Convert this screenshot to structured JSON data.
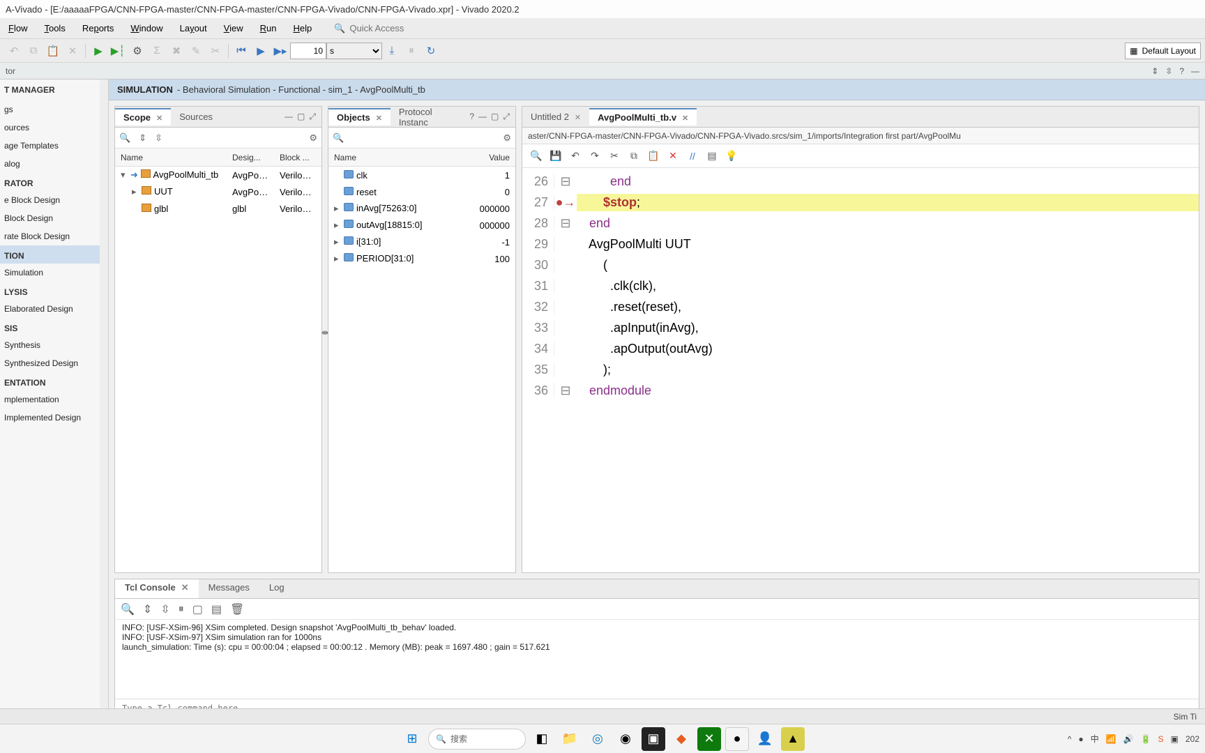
{
  "window": {
    "title": "A-Vivado - [E:/aaaaaFPGA/CNN-FPGA-master/CNN-FPGA-master/CNN-FPGA-Vivado/CNN-FPGA-Vivado.xpr] - Vivado 2020.2"
  },
  "menu": [
    "Flow",
    "Tools",
    "Reports",
    "Window",
    "Layout",
    "View",
    "Run",
    "Help"
  ],
  "quick_access": {
    "placeholder": "Quick Access"
  },
  "toolbar": {
    "time_value": "10",
    "time_unit": "s",
    "layout": "Default Layout"
  },
  "nav_title": "tor",
  "sim_header": {
    "label": "SIMULATION",
    "desc": "- Behavioral Simulation - Functional - sim_1 - AvgPoolMulti_tb"
  },
  "left_nav": {
    "title": "T MANAGER",
    "groups": [
      {
        "items": [
          "gs",
          "ources",
          "age Templates",
          "alog"
        ]
      },
      {
        "cat": "RATOR",
        "items": [
          "e Block Design",
          "Block Design",
          "rate Block Design"
        ]
      },
      {
        "cat": "TION",
        "sel": true,
        "items": [
          "Simulation"
        ]
      },
      {
        "cat": "LYSIS",
        "items": [
          " Elaborated Design"
        ]
      },
      {
        "cat": "SIS",
        "items": [
          "Synthesis",
          " Synthesized Design"
        ]
      },
      {
        "cat": "ENTATION",
        "items": [
          "mplementation",
          " Implemented Design"
        ]
      }
    ]
  },
  "scope": {
    "tabs": [
      "Scope",
      "Sources"
    ],
    "cols": [
      "Name",
      "Desig...",
      "Block ..."
    ],
    "rows": [
      {
        "indent": 0,
        "exp": "▾",
        "arrow": true,
        "name": "AvgPoolMulti_tb",
        "d": "AvgPoolM",
        "b": "Verilog Mo"
      },
      {
        "indent": 1,
        "exp": "▸",
        "name": "UUT",
        "d": "AvgPoolM",
        "b": "Verilog Mo"
      },
      {
        "indent": 1,
        "exp": "",
        "name": "glbl",
        "d": "glbl",
        "b": "Verilog Mo"
      }
    ]
  },
  "objects": {
    "tabs": [
      "Objects",
      "Protocol Instanc"
    ],
    "cols": [
      "Name",
      "Value"
    ],
    "rows": [
      {
        "exp": "",
        "name": "clk",
        "val": "1"
      },
      {
        "exp": "",
        "name": "reset",
        "val": "0"
      },
      {
        "exp": "▸",
        "name": "inAvg[75263:0]",
        "val": "000000"
      },
      {
        "exp": "▸",
        "name": "outAvg[18815:0]",
        "val": "000000"
      },
      {
        "exp": "▸",
        "name": "i[31:0]",
        "val": "-1"
      },
      {
        "exp": "▸",
        "name": "PERIOD[31:0]",
        "val": "100"
      }
    ]
  },
  "editor": {
    "tabs": [
      {
        "label": "Untitled 2",
        "active": false
      },
      {
        "label": "AvgPoolMulti_tb.v",
        "active": true
      }
    ],
    "path": "aster/CNN-FPGA-master/CNN-FPGA-Vivado/CNN-FPGA-Vivado.srcs/sim_1/imports/Integration first part/AvgPoolMu",
    "lines": [
      {
        "n": 26,
        "fold": "⊟",
        "t": "        end"
      },
      {
        "n": 27,
        "bp": "●→",
        "hl": true,
        "t": "      $stop;",
        "stop": true
      },
      {
        "n": 28,
        "fold": "⊟",
        "t": "  end"
      },
      {
        "n": 29,
        "t": "  AvgPoolMulti UUT"
      },
      {
        "n": 30,
        "t": "      ("
      },
      {
        "n": 31,
        "t": "        .clk(clk),"
      },
      {
        "n": 32,
        "t": "        .reset(reset),"
      },
      {
        "n": 33,
        "t": "        .apInput(inAvg),"
      },
      {
        "n": 34,
        "t": "        .apOutput(outAvg)"
      },
      {
        "n": 35,
        "t": "      );"
      },
      {
        "n": 36,
        "fold": "⊟",
        "t": "  endmodule",
        "kw": true
      }
    ]
  },
  "console": {
    "tabs": [
      "Tcl Console",
      "Messages",
      "Log"
    ],
    "lines": [
      "INFO: [USF-XSim-96] XSim completed. Design snapshot 'AvgPoolMulti_tb_behav' loaded.",
      "INFO: [USF-XSim-97] XSim simulation ran for 1000ns",
      "launch_simulation: Time (s): cpu = 00:00:04 ; elapsed = 00:00:12 . Memory (MB): peak = 1697.480 ; gain = 517.621"
    ],
    "input_placeholder": "Type a Tcl command here"
  },
  "status": {
    "right": "Sim Ti"
  },
  "taskbar": {
    "search": "搜索",
    "date": "202"
  }
}
